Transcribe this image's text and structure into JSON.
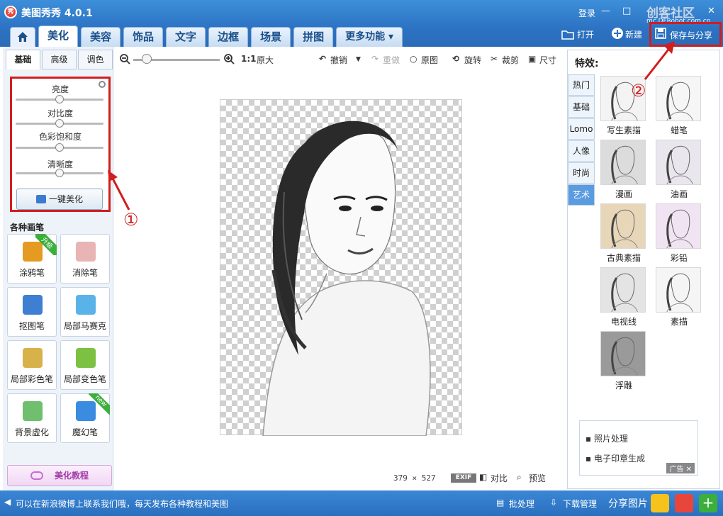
{
  "window": {
    "title": "美图秀秀 4.0.1",
    "logo_text": "秀",
    "login": "登录",
    "min": "—",
    "max": "□",
    "close": "✕"
  },
  "watermark": {
    "text": "创客社区",
    "sub": "mc.DFRobot.com.cn"
  },
  "tabs": [
    "美化",
    "美容",
    "饰品",
    "文字",
    "边框",
    "场景",
    "拼图",
    "更多功能 ▾"
  ],
  "top_actions": {
    "open": "打开",
    "new": "新建",
    "save_share": "保存与分享"
  },
  "left": {
    "subtabs": [
      "基础",
      "高级",
      "调色"
    ],
    "sliders": [
      {
        "label": "亮度",
        "value": 0.5
      },
      {
        "label": "对比度",
        "value": 0.5
      },
      {
        "label": "色彩饱和度",
        "value": 0.5
      },
      {
        "label": "清晰度",
        "value": 0.5
      }
    ],
    "onekey": "一键美化",
    "brushes_title": "各种画笔",
    "brushes": [
      {
        "label": "涂鸦笔",
        "badge": "升级",
        "icon": "paintbrush-icon",
        "color": "#e59a22"
      },
      {
        "label": "消除笔",
        "badge": "",
        "icon": "eraser-icon",
        "color": "#e8b4b4"
      },
      {
        "label": "抠图笔",
        "badge": "",
        "icon": "cutout-pen-icon",
        "color": "#3e7fd1"
      },
      {
        "label": "局部马赛克",
        "badge": "",
        "icon": "mosaic-icon",
        "color": "#5ab3e8"
      },
      {
        "label": "局部彩色笔",
        "badge": "",
        "icon": "color-brush-icon",
        "color": "#d7b24a"
      },
      {
        "label": "局部变色笔",
        "badge": "",
        "icon": "recolor-bucket-icon",
        "color": "#7cc142"
      },
      {
        "label": "背景虚化",
        "badge": "",
        "icon": "background-blur-icon",
        "color": "#6fbf6f"
      },
      {
        "label": "魔幻笔",
        "badge": "new",
        "icon": "magic-pen-icon",
        "color": "#3b8be0"
      }
    ],
    "tutorial": "美化教程"
  },
  "toolbar": {
    "zoom_level": 0.1,
    "ratio": "1:1",
    "original_size": "原大",
    "undo": "撤销",
    "redo": "重做",
    "original": "原图",
    "rotate": "旋转",
    "crop": "裁剪",
    "resize": "尺寸"
  },
  "canvas": {
    "width": "379",
    "height": "527",
    "times": "×",
    "exif": "EXIF",
    "compare": "对比",
    "preview": "预览"
  },
  "right": {
    "title": "特效:",
    "categories": [
      "热门",
      "基础",
      "Lomo",
      "人像",
      "时尚",
      "艺术"
    ],
    "active_category": 5,
    "effects": [
      "写生素描",
      "蜡笔",
      "漫画",
      "油画",
      "古典素描",
      "彩铅",
      "电视线",
      "素描",
      "浮雕"
    ],
    "ad_items": [
      "照片处理",
      "电子印章生成"
    ],
    "ad_tag": "广告"
  },
  "status": {
    "message": "可以在新浪微博上联系我们哦，每天发布各种教程和美图",
    "batch": "批处理",
    "download": "下载管理",
    "share": "分享图片"
  },
  "annotations": {
    "one": "①",
    "two": "②"
  },
  "colors": {
    "accent": "#2c73c3",
    "highlight": "#d21d1d"
  }
}
